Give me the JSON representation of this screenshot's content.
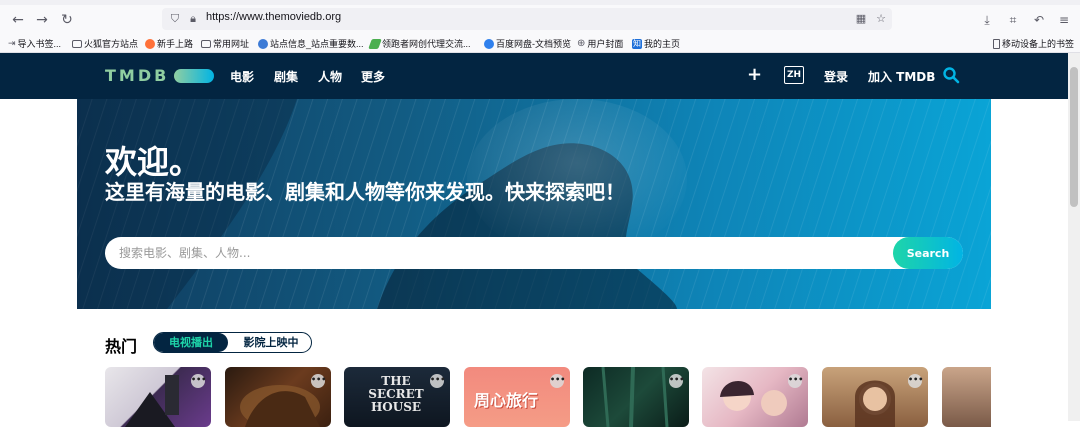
{
  "browser": {
    "url": "https://www.themoviedb.org",
    "bookmarks": [
      {
        "label": "导入书签..."
      },
      {
        "label": "火狐官方站点"
      },
      {
        "label": "新手上路"
      },
      {
        "label": "常用网址"
      },
      {
        "label": "站点信息_站点重要数..."
      },
      {
        "label": "领跑者网创代理交流..."
      },
      {
        "label": "百度网盘-文档预览"
      },
      {
        "label": "用户封面"
      },
      {
        "label": "我的主页"
      }
    ],
    "mobile_bookmarks": "移动设备上的书签"
  },
  "header": {
    "logo": "TMDB",
    "nav": [
      "电影",
      "剧集",
      "人物",
      "更多"
    ],
    "lang": "ZH",
    "login": "登录",
    "join": "加入 TMDB"
  },
  "hero": {
    "title": "欢迎。",
    "subtitle": "这里有海量的电影、剧集和人物等你来发现。快来探索吧！",
    "search_placeholder": "搜索电影、剧集、人物...",
    "search_button": "Search"
  },
  "trending": {
    "title": "热门",
    "tabs": [
      "电视播出",
      "影院上映中"
    ]
  },
  "cards": [
    {
      "text": ""
    },
    {
      "text": ""
    },
    {
      "text": "THE SECRET HOUSE"
    },
    {
      "text": "周心旅行"
    },
    {
      "text": ""
    },
    {
      "text": ""
    },
    {
      "text": ""
    },
    {
      "text": ""
    }
  ],
  "colors": {
    "primary": "#032541",
    "accent_green": "#90cea1",
    "accent_blue": "#01b4e4",
    "search_green": "#1ed5a9"
  }
}
